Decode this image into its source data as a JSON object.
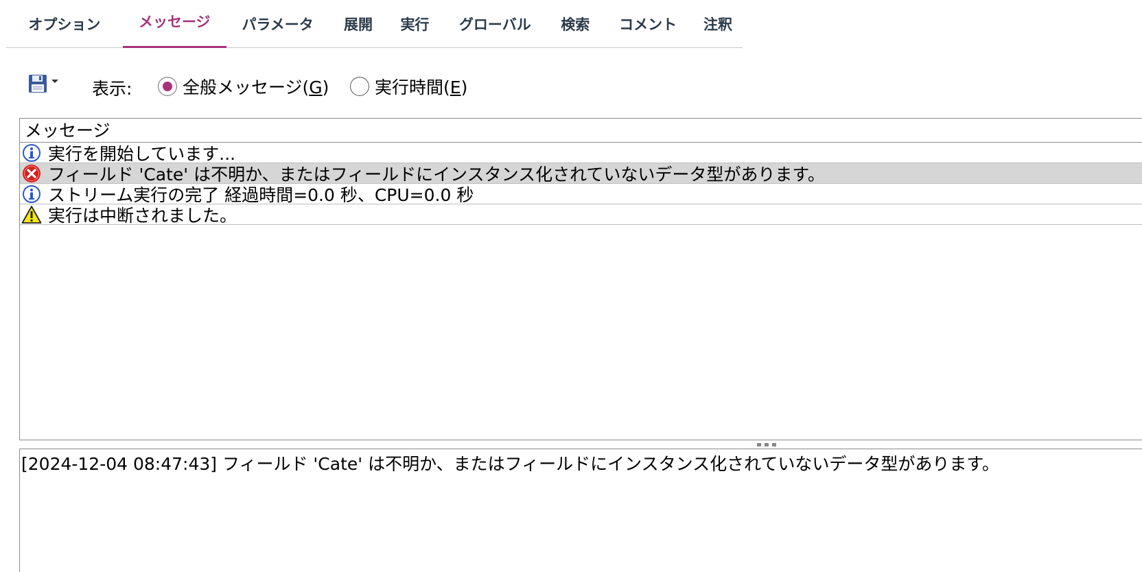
{
  "tabs": [
    {
      "label": "オプション",
      "active": false
    },
    {
      "label": "メッセージ",
      "active": true
    },
    {
      "label": "パラメータ",
      "active": false
    },
    {
      "label": "展開",
      "active": false
    },
    {
      "label": "実行",
      "active": false
    },
    {
      "label": "グローバル",
      "active": false
    },
    {
      "label": "検索",
      "active": false
    },
    {
      "label": "コメント",
      "active": false
    },
    {
      "label": "注釈",
      "active": false
    }
  ],
  "toolbar": {
    "save_icon": "floppy-disk-icon",
    "show_label": "表示:",
    "radio_general": {
      "label": "全般メッセージ(",
      "mnemonic": "G",
      "suffix": ")",
      "checked": true
    },
    "radio_exec": {
      "label": "実行時間(",
      "mnemonic": "E",
      "suffix": ")",
      "checked": false
    }
  },
  "messages": {
    "header": "メッセージ",
    "rows": [
      {
        "icon": "info-icon",
        "text": "実行を開始しています..."
      },
      {
        "icon": "error-icon",
        "text": "フィールド 'Cate' は不明か、またはフィールドにインスタンス化されていないデータ型があります。",
        "selected": true
      },
      {
        "icon": "info-icon",
        "text": "ストリーム実行の完了 経過時間=0.0 秒、CPU=0.0 秒"
      },
      {
        "icon": "warning-icon",
        "text": "実行は中断されました。"
      }
    ]
  },
  "detail": {
    "text": "[2024-12-04 08:47:43] フィールド 'Cate' は不明か、またはフィールドにインスタンス化されていないデータ型があります。"
  },
  "colors": {
    "accent": "#a8327a",
    "tab_text": "#2b3a4a",
    "selected_row": "#d6d6d6"
  }
}
